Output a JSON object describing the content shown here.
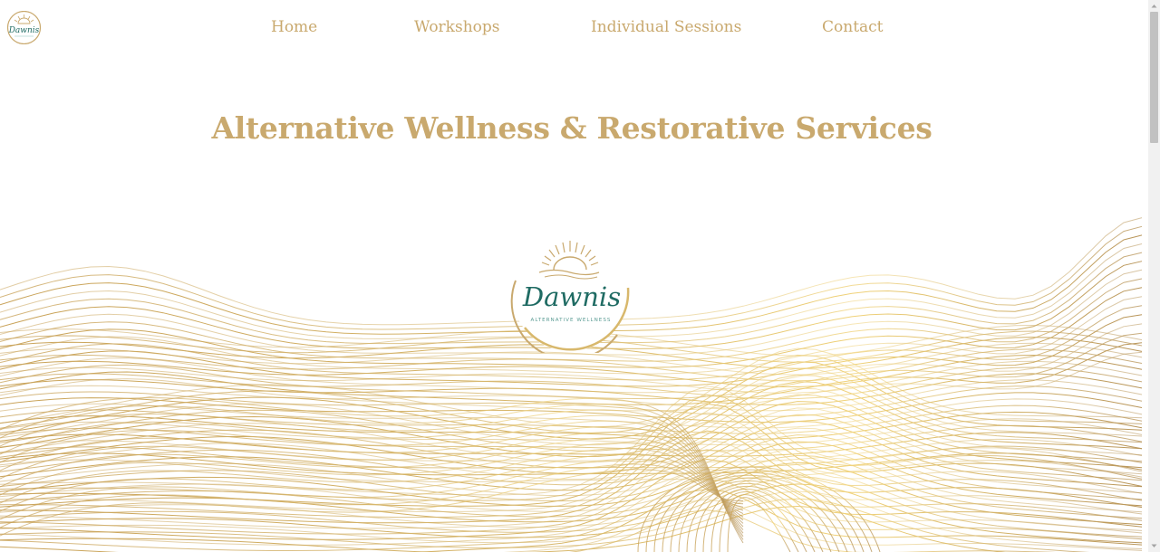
{
  "nav": {
    "items": [
      {
        "label": "Home"
      },
      {
        "label": "Workshops"
      },
      {
        "label": "Individual Sessions"
      },
      {
        "label": "Contact"
      }
    ]
  },
  "hero": {
    "title": "Alternative Wellness & Restorative Services"
  },
  "logo": {
    "wordmark": "Dawnis",
    "tagline": "ALTERNATIVE WELLNESS"
  },
  "colors": {
    "gold": "#c9a96e",
    "teal": "#1f6b63",
    "background": "#ffffff"
  },
  "icons": {
    "site_logo": "dawnis-sun-logo-icon",
    "scroll_up": "triangle-up-icon",
    "scroll_down": "triangle-down-icon"
  }
}
